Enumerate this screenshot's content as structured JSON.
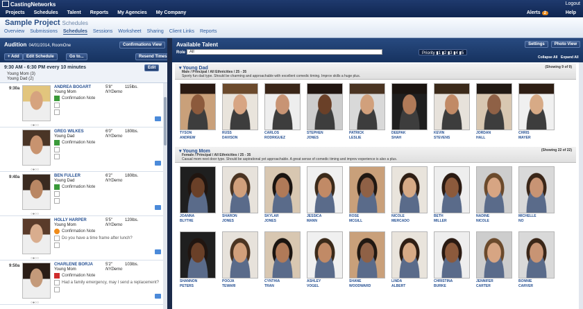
{
  "brand": {
    "logo_text": "CastingNetworks",
    "logout": "Logout"
  },
  "nav": {
    "items": [
      "Projects",
      "Schedules",
      "Talent",
      "Reports",
      "My Agencies",
      "My Company"
    ],
    "alerts_label": "Alerts",
    "alerts_count": "2",
    "help": "Help"
  },
  "project": {
    "title": "Sample Project",
    "subtitle": "Schedules",
    "tabs": [
      "Overview",
      "Submissions",
      "Schedules",
      "Sessions",
      "Worksheet",
      "Sharing",
      "Client Links",
      "Reports"
    ],
    "active_tab": "Schedules"
  },
  "audition": {
    "title": "Audition",
    "date_place": "04/01/2014, RoomOne",
    "confirmations_view": "Confirmations View",
    "add": "+ Add",
    "edit_schedule": "Edit Schedule",
    "goto": "Go to...",
    "resend_times": "Resend Times",
    "block_title": "9:30 AM - 6:30 PM every 10 minutes",
    "block_edit": "Edit",
    "block_roles": [
      "Young Mom",
      "Young Dad"
    ],
    "block_counts": [
      "(3)",
      "(2)"
    ],
    "slots": [
      {
        "time": "9:30a",
        "name": "ANDREA BOGART",
        "role": "Young Mom",
        "height": "5'8\"",
        "weight": "115lbs.",
        "rep": "NYDemo",
        "status": "ok",
        "note": "Confirmation Note",
        "extra": ""
      },
      {
        "time": "",
        "name": "GREG WILKES",
        "role": "Young Dad",
        "height": "6'0\"",
        "weight": "180lbs.",
        "rep": "NYDemo",
        "status": "ok",
        "note": "Confirmation Note",
        "extra": ""
      },
      {
        "time": "9:40a",
        "name": "BEN FULLER",
        "role": "Young Dad",
        "height": "6'2\"",
        "weight": "180lbs.",
        "rep": "NYDemo",
        "status": "ok",
        "note": "Confirmation Note",
        "extra": ""
      },
      {
        "time": "",
        "name": "HOLLY HARPER",
        "role": "Young Mom",
        "height": "5'5\"",
        "weight": "120lbs.",
        "rep": "NYDemo",
        "status": "q",
        "note": "Confirmation Note",
        "extra": "Do you have a time frame after lunch?"
      },
      {
        "time": "9:50a",
        "name": "CHARLENE BORJA",
        "role": "Young Mom",
        "height": "5'2\"",
        "weight": "103lbs.",
        "rep": "NYDemo",
        "status": "x",
        "note": "Confirmation Note",
        "extra": "Had a family emergency, may I send a replacement?"
      }
    ]
  },
  "talent": {
    "title": "Available Talent",
    "role_label": "Role",
    "role_value": "All",
    "priority": "Priority",
    "settings": "Settings",
    "photo_view": "Photo View",
    "collapse_all": "Collapse All",
    "expand_all": "Expand All",
    "sections": [
      {
        "name": "Young Dad",
        "desc1": "Male / Principal / All Ethnicities / 25 - 35",
        "desc2": "Sporty fun dad type. Should be charming and approachable with excellent comedic timing. Improv skills a huge plus.",
        "showing": "(Showing 9 of 9)",
        "people": [
          [
            "TYSON",
            "ANDREW"
          ],
          [
            "RUSS",
            "DAVISON"
          ],
          [
            "CARLOS",
            "RODRIGUEZ"
          ],
          [
            "STEPHEN",
            "JONES"
          ],
          [
            "PATRICK",
            "LESLIE"
          ],
          [
            "DEEPAK",
            "SHAH"
          ],
          [
            "KEVIN",
            "STEVENS"
          ],
          [
            "JORDAN",
            "HALL"
          ],
          [
            "CHRIS",
            "MAYER"
          ]
        ]
      },
      {
        "name": "Young Mom",
        "desc1": "Female / Principal / All Ethnicities / 25 - 35",
        "desc2": "Casual mom next door type. Should be aspirational yet approachable. A great sense of comedic timing and improv experience is also a plus.",
        "showing": "(Showing 22 of 22)",
        "people": [
          [
            "JOANNA",
            "BLYTHE"
          ],
          [
            "SHARON",
            "JONES"
          ],
          [
            "SKYLAR",
            "JONES"
          ],
          [
            "JESSICA",
            "MANN"
          ],
          [
            "ROSE",
            "MCGILL"
          ],
          [
            "NICOLE",
            "MERCADO"
          ],
          [
            "BETH",
            "MILLER"
          ],
          [
            "NADINE",
            "NICOLE"
          ],
          [
            "MICHELLE",
            "NO"
          ],
          [
            "SHANNON",
            "PETERS"
          ],
          [
            "POOJA",
            "TEWARI"
          ],
          [
            "CYNTHIA",
            "TRAN"
          ],
          [
            "ASHLEY",
            "VOGEL"
          ],
          [
            "SHANE",
            "WOODWARD"
          ],
          [
            "LINDA",
            "ALBERT"
          ],
          [
            "CHRISTINA",
            "BURKE"
          ],
          [
            "JENNIFER",
            "CARTER"
          ],
          [
            "BONNIE",
            "CARVER"
          ]
        ]
      }
    ]
  }
}
